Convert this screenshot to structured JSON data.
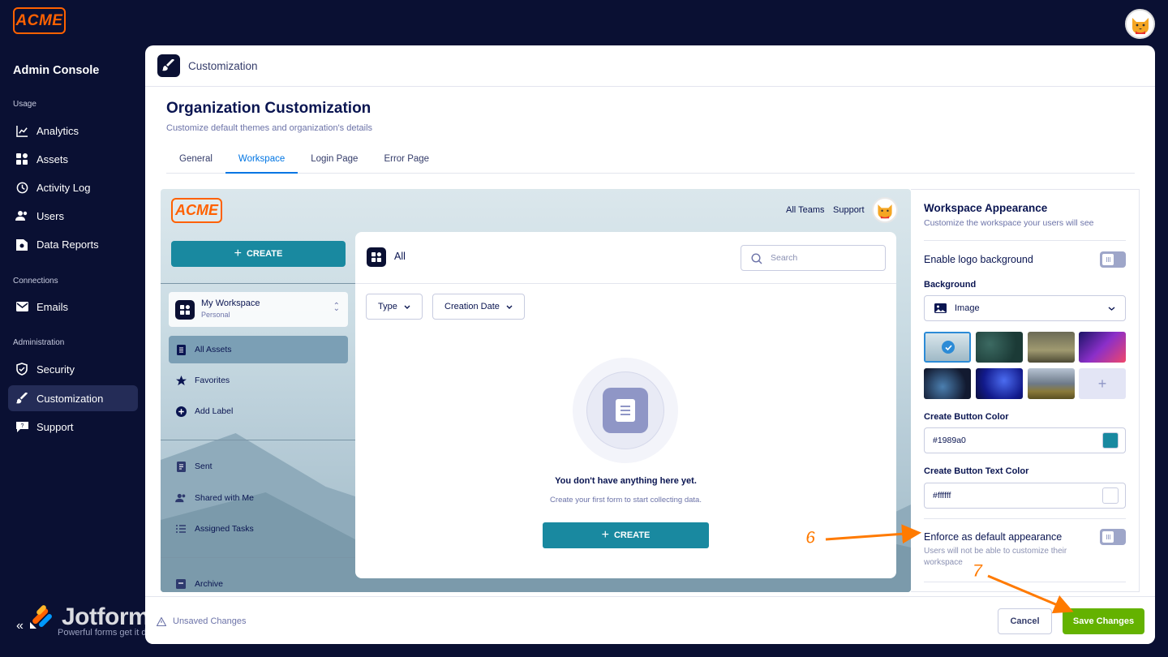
{
  "app": {
    "logo_text": "ACME",
    "brand_color": "#ff6100"
  },
  "sidebar": {
    "title": "Admin Console",
    "sections": {
      "usage": "Usage",
      "connections": "Connections",
      "administration": "Administration"
    },
    "items": [
      {
        "label": "Analytics",
        "icon": "chart-line-icon"
      },
      {
        "label": "Assets",
        "icon": "grid-icon"
      },
      {
        "label": "Activity Log",
        "icon": "clock-icon"
      },
      {
        "label": "Users",
        "icon": "users-icon"
      },
      {
        "label": "Data Reports",
        "icon": "report-icon"
      },
      {
        "label": "Emails",
        "icon": "mail-icon"
      },
      {
        "label": "Security",
        "icon": "shield-icon"
      },
      {
        "label": "Customization",
        "icon": "brush-icon"
      },
      {
        "label": "Support",
        "icon": "chat-icon"
      }
    ],
    "active": "Customization",
    "footer_brand": "Jotform",
    "footer_tagline": "Powerful forms get it done.",
    "collapse_glyph": "«"
  },
  "topbar": {
    "title": "Customization"
  },
  "page": {
    "title": "Organization Customization",
    "subtitle": "Customize default themes and organization's details",
    "tabs": [
      "General",
      "Workspace",
      "Login Page",
      "Error Page"
    ],
    "active_tab": "Workspace"
  },
  "preview": {
    "logo_text": "ACME",
    "header_links": [
      "All Teams",
      "Support"
    ],
    "create_label": "CREATE",
    "workspace": {
      "name": "My Workspace",
      "type": "Personal"
    },
    "nav": [
      "All Assets",
      "Favorites",
      "Add Label",
      "Sent",
      "Shared with Me",
      "Assigned Tasks",
      "Archive"
    ],
    "card": {
      "title": "All",
      "search_placeholder": "Search",
      "filters": [
        "Type",
        "Creation Date"
      ],
      "empty_title": "You don't have anything here yet.",
      "empty_subtitle": "Create your first form to start collecting data.",
      "create_label": "CREATE"
    }
  },
  "appearance": {
    "title": "Workspace Appearance",
    "subtitle": "Customize the workspace your users will see",
    "logo_bg_label": "Enable logo background",
    "logo_bg_enabled": false,
    "background_label": "Background",
    "background_value": "Image",
    "thumbnails": [
      "mountain-mist",
      "green-texture",
      "castle-fog",
      "purple-gradient",
      "aurora",
      "blue-waves",
      "snowy-peak",
      "add"
    ],
    "selected_thumbnail": 0,
    "button_color_label": "Create Button Color",
    "button_color": "#1989a0",
    "button_text_color_label": "Create Button Text Color",
    "button_text_color": "#ffffff",
    "enforce_label": "Enforce as default appearance",
    "enforce_note": "Users will not be able to customize their workspace",
    "enforce_enabled": false
  },
  "footer": {
    "unsaved": "Unsaved Changes",
    "cancel": "Cancel",
    "save": "Save Changes"
  },
  "annotations": [
    "6",
    "7"
  ]
}
